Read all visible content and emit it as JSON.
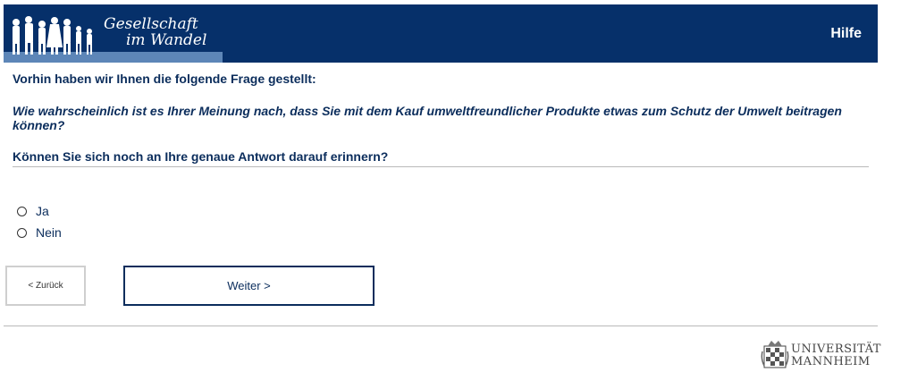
{
  "header": {
    "logo_line1": "Gesellschaft",
    "logo_line2": "im Wandel",
    "help_label": "Hilfe",
    "background_color": "#06306a"
  },
  "content": {
    "intro": "Vorhin haben wir Ihnen die folgende Frage gestellt:",
    "question": "Wie wahrscheinlich ist es Ihrer Meinung nach, dass Sie mit dem Kauf umweltfreundlicher Produkte etwas zum Schutz der Umwelt beitragen können?",
    "prompt": "Können Sie sich noch an Ihre genaue Antwort darauf erinnern?",
    "text_color": "#0b2d5c"
  },
  "options": [
    {
      "label": "Ja"
    },
    {
      "label": "Nein"
    }
  ],
  "navigation": {
    "back_label": "< Zurück",
    "next_label": "Weiter >"
  },
  "footer": {
    "university_line1": "UNIVERSITÄT",
    "university_line2": "MANNHEIM"
  }
}
